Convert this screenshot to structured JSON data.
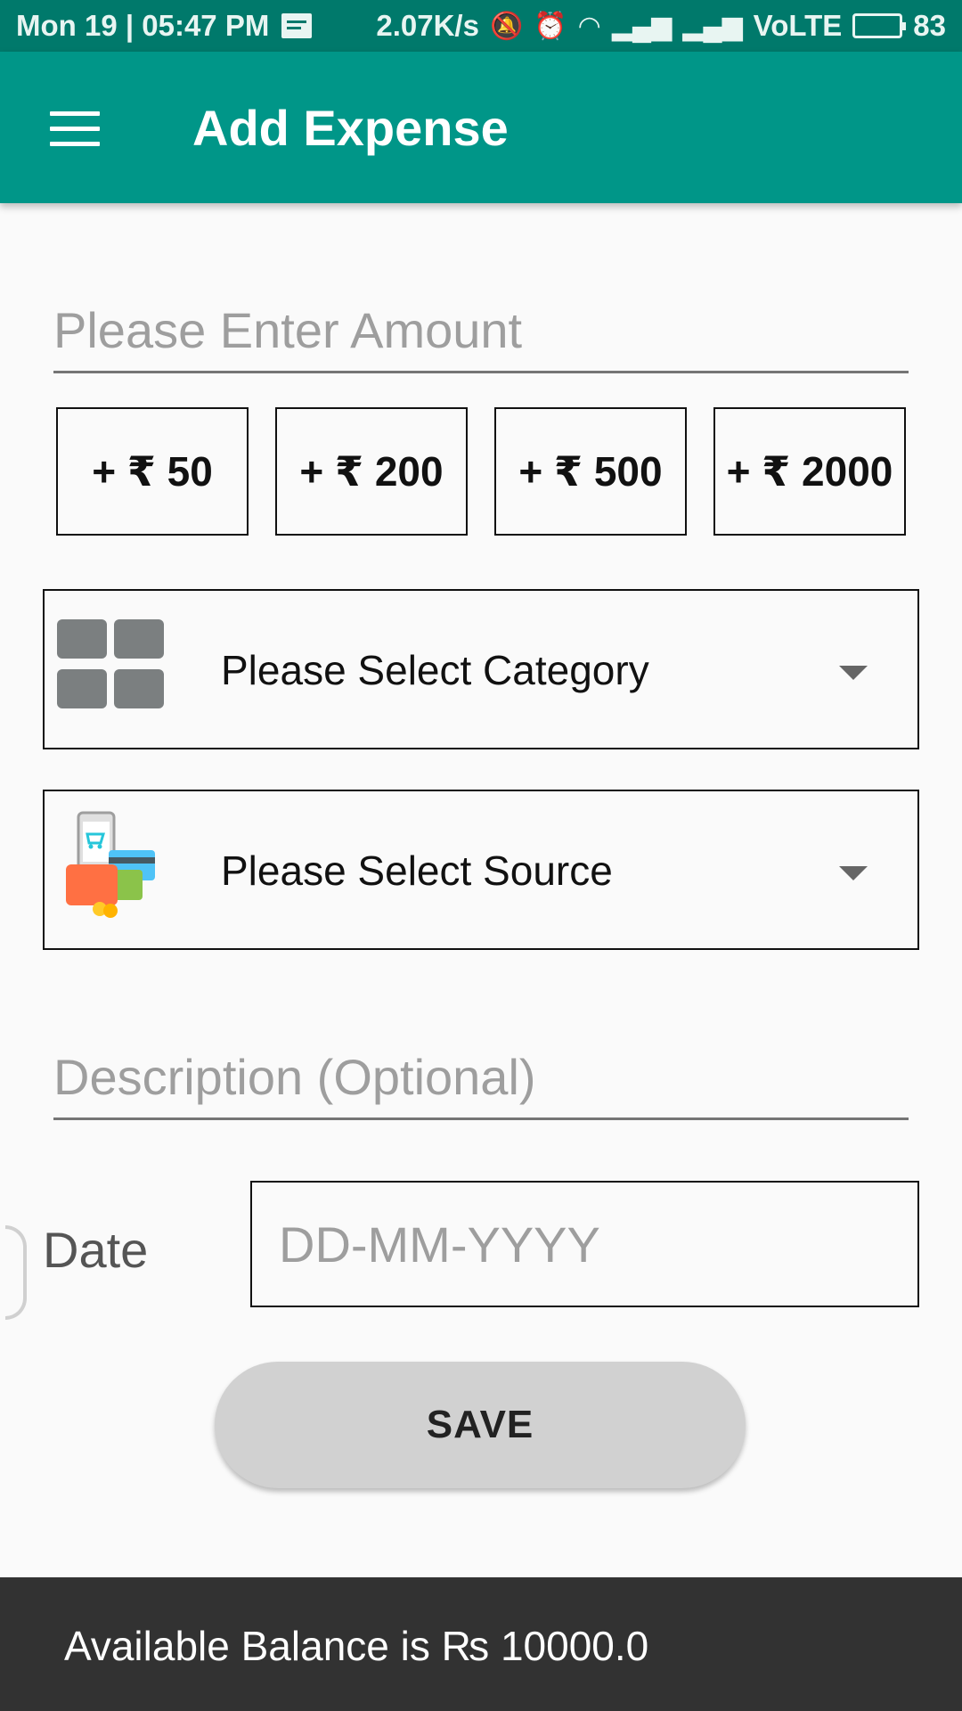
{
  "status_bar": {
    "time": "Mon 19 | 05:47 PM",
    "speed": "2.07K/s",
    "network": "VoLTE",
    "battery": "83",
    "icons": [
      "notification-icon",
      "bell-off-icon",
      "alarm-icon",
      "wifi-icon",
      "signal-icon",
      "battery-icon"
    ]
  },
  "app_bar": {
    "title": "Add Expense",
    "menu_icon": "hamburger-menu-icon"
  },
  "amount": {
    "placeholder": "Please Enter Amount",
    "value": ""
  },
  "quick_add": [
    {
      "label": "+ ₹ 50"
    },
    {
      "label": "+ ₹ 200"
    },
    {
      "label": "+ ₹ 500"
    },
    {
      "label": "+ ₹ 2000"
    }
  ],
  "category": {
    "label": "Please Select Category",
    "icon": "category-grid-icon"
  },
  "source": {
    "label": "Please Select Source",
    "icon": "payment-source-icon"
  },
  "description": {
    "placeholder": "Description (Optional)",
    "value": ""
  },
  "date": {
    "label": "Date",
    "placeholder": "DD-MM-YYYY",
    "value": ""
  },
  "save_button": {
    "label": "SAVE"
  },
  "balance_bar": {
    "text": "Available Balance is ₨ 10000.0"
  },
  "colors": {
    "accent": "#009688",
    "status_bar": "#00796b",
    "background": "#fafafa",
    "balance_bar": "#323232",
    "save_button": "#d1d1d1"
  }
}
